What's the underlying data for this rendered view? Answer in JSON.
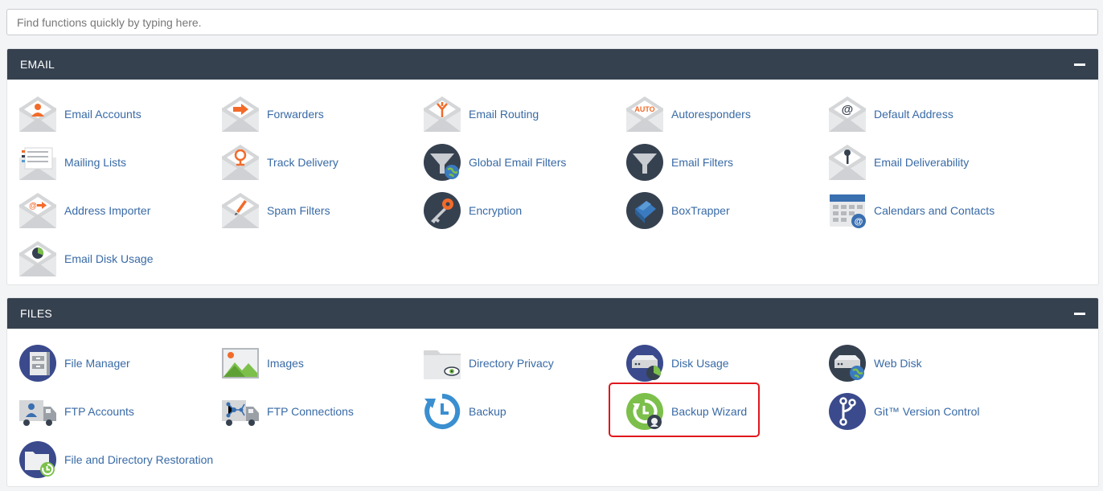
{
  "search": {
    "placeholder": "Find functions quickly by typing here."
  },
  "sections": [
    {
      "title": "EMAIL",
      "items": [
        {
          "label": "Email Accounts",
          "icon": "email-accounts-icon"
        },
        {
          "label": "Forwarders",
          "icon": "forwarders-icon"
        },
        {
          "label": "Email Routing",
          "icon": "email-routing-icon"
        },
        {
          "label": "Autoresponders",
          "icon": "autoresponders-icon"
        },
        {
          "label": "Default Address",
          "icon": "default-address-icon"
        },
        {
          "label": "Mailing Lists",
          "icon": "mailing-lists-icon"
        },
        {
          "label": "Track Delivery",
          "icon": "track-delivery-icon"
        },
        {
          "label": "Global Email Filters",
          "icon": "global-email-filters-icon"
        },
        {
          "label": "Email Filters",
          "icon": "email-filters-icon"
        },
        {
          "label": "Email Deliverability",
          "icon": "email-deliverability-icon"
        },
        {
          "label": "Address Importer",
          "icon": "address-importer-icon"
        },
        {
          "label": "Spam Filters",
          "icon": "spam-filters-icon"
        },
        {
          "label": "Encryption",
          "icon": "encryption-icon"
        },
        {
          "label": "BoxTrapper",
          "icon": "boxtrapper-icon"
        },
        {
          "label": "Calendars and Contacts",
          "icon": "calendars-contacts-icon"
        },
        {
          "label": "Email Disk Usage",
          "icon": "email-disk-usage-icon"
        }
      ]
    },
    {
      "title": "FILES",
      "items": [
        {
          "label": "File Manager",
          "icon": "file-manager-icon"
        },
        {
          "label": "Images",
          "icon": "images-icon"
        },
        {
          "label": "Directory Privacy",
          "icon": "directory-privacy-icon"
        },
        {
          "label": "Disk Usage",
          "icon": "disk-usage-icon"
        },
        {
          "label": "Web Disk",
          "icon": "web-disk-icon"
        },
        {
          "label": "FTP Accounts",
          "icon": "ftp-accounts-icon"
        },
        {
          "label": "FTP Connections",
          "icon": "ftp-connections-icon"
        },
        {
          "label": "Backup",
          "icon": "backup-icon"
        },
        {
          "label": "Backup Wizard",
          "icon": "backup-wizard-icon",
          "highlighted": true
        },
        {
          "label": "Git™ Version Control",
          "icon": "git-version-control-icon"
        },
        {
          "label": "File and Directory Restoration",
          "icon": "file-directory-restoration-icon"
        }
      ]
    }
  ],
  "colors": {
    "header_bg": "#364150",
    "link": "#386aa6",
    "highlight": "#e0161b"
  }
}
